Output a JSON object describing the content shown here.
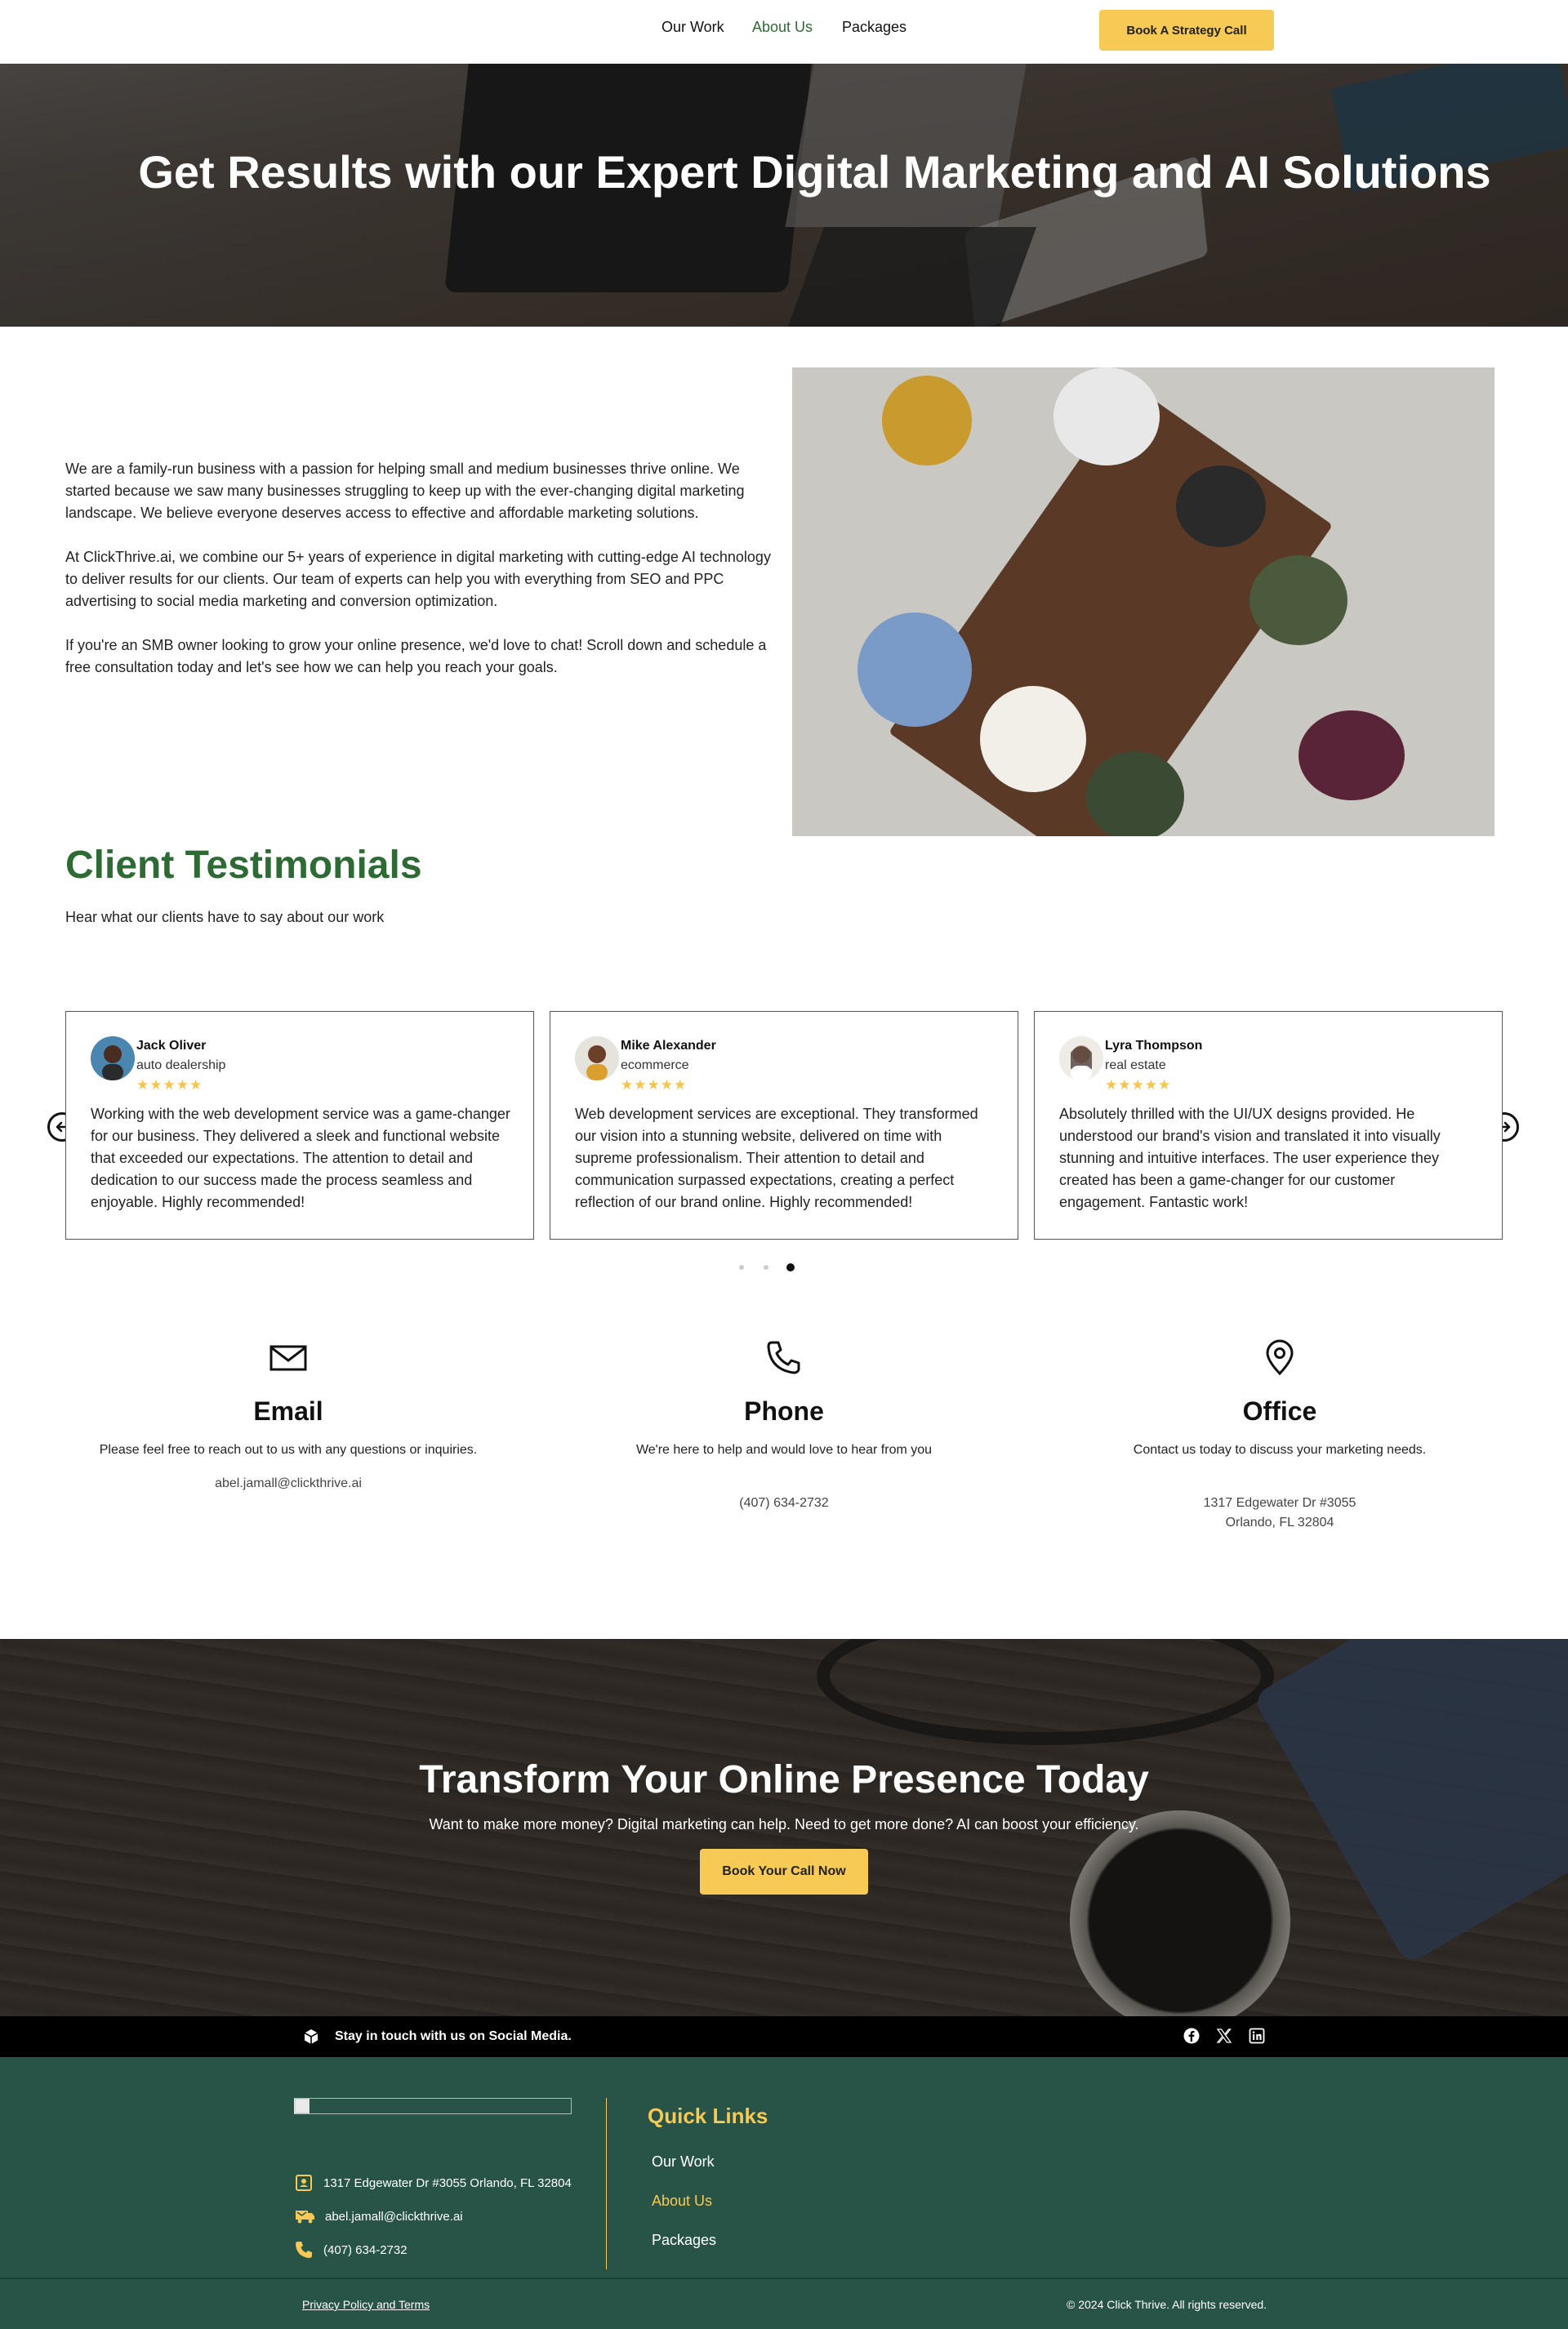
{
  "nav": {
    "items": [
      "Our Work",
      "About Us",
      "Packages"
    ],
    "active": "About Us",
    "cta_label": "Book A Strategy Call",
    "cta_color": "#f7c955"
  },
  "hero": {
    "title": "Get Results with our Expert Digital Marketing and AI Solutions"
  },
  "about": {
    "paragraphs": [
      "We are a family-run business with a passion for helping small and medium businesses thrive online. We started because we saw many businesses struggling to keep up with the ever-changing digital marketing landscape.  We believe everyone deserves access to effective and affordable marketing solutions.",
      "At ClickThrive.ai, we combine our 5+ years of experience in digital marketing with cutting-edge AI technology to deliver results for our clients.  Our team of experts can help you with everything from SEO and PPC advertising to social media marketing and conversion optimization.",
      "If you're an SMB owner looking to grow your online presence, we'd love to chat!  Scroll down and schedule a free consultation today and let's see how we can help you reach your goals."
    ]
  },
  "testimonials": {
    "title": "Client Testimonials",
    "subtitle": "Hear what our clients have to say about our work",
    "cards": [
      {
        "name": "Jack Oliver",
        "role": "auto dealership",
        "stars": "★★★★★",
        "quote": "Working with the web development service was a game-changer for our business. They delivered a sleek and functional website that exceeded our expectations. The attention to detail and dedication to our success made the process seamless and enjoyable. Highly recommended!"
      },
      {
        "name": "Mike Alexander",
        "role": "ecommerce",
        "stars": "★★★★★",
        "quote": "Web development services are exceptional. They transformed our vision into a stunning website, delivered on time with supreme professionalism. Their attention to detail and communication surpassed expectations, creating a perfect reflection of our brand online. Highly recommended!"
      },
      {
        "name": "Lyra Thompson",
        "role": "real estate",
        "stars": "★★★★★",
        "quote": "Absolutely thrilled with the UI/UX designs provided. He understood our brand's vision and translated it into visually stunning and intuitive interfaces. The user experience they created has been a game-changer for our customer engagement. Fantastic work!"
      }
    ],
    "prev_icon": "arrow-left-circle-icon",
    "next_icon": "arrow-right-circle-icon",
    "active_slide": 3,
    "slide_count": 3,
    "star_color": "#f4c44e"
  },
  "contact": [
    {
      "icon": "mail-icon",
      "title": "Email",
      "desc": "Please feel free to reach out to us with any questions or inquiries.",
      "value": "abel.jamall@clickthrive.ai"
    },
    {
      "icon": "phone-icon",
      "title": "Phone",
      "desc": "We're here to help and would love to hear from you",
      "value": "(407) 634-2732"
    },
    {
      "icon": "map-pin-icon",
      "title": "Office",
      "desc": "Contact us today to discuss your marketing needs.",
      "value_line1": "1317 Edgewater Dr #3055",
      "value_line2": "Orlando, FL 32804"
    }
  ],
  "cta_band": {
    "title": "Transform Your Online Presence Today",
    "subtitle": "Want to make more money? Digital marketing can help. Need to get more done? AI can boost your efficiency.",
    "button": "Book Your Call Now"
  },
  "social": {
    "message": "Stay in touch with us on Social Media.",
    "icons": [
      "facebook-icon",
      "x-icon",
      "linkedin-icon"
    ]
  },
  "footer": {
    "address": "1317 Edgewater Dr #3055 Orlando, FL 32804",
    "email": "abel.jamall@clickthrive.ai",
    "phone": "(407) 634-2732",
    "quick_links_title": "Quick Links",
    "links": [
      "Our Work",
      "About Us",
      "Packages"
    ],
    "privacy": "Privacy Policy and Terms",
    "copyright": "© 2024 Click Thrive. All rights reserved.",
    "bg_color": "#275447",
    "accent_color": "#f7c955"
  }
}
